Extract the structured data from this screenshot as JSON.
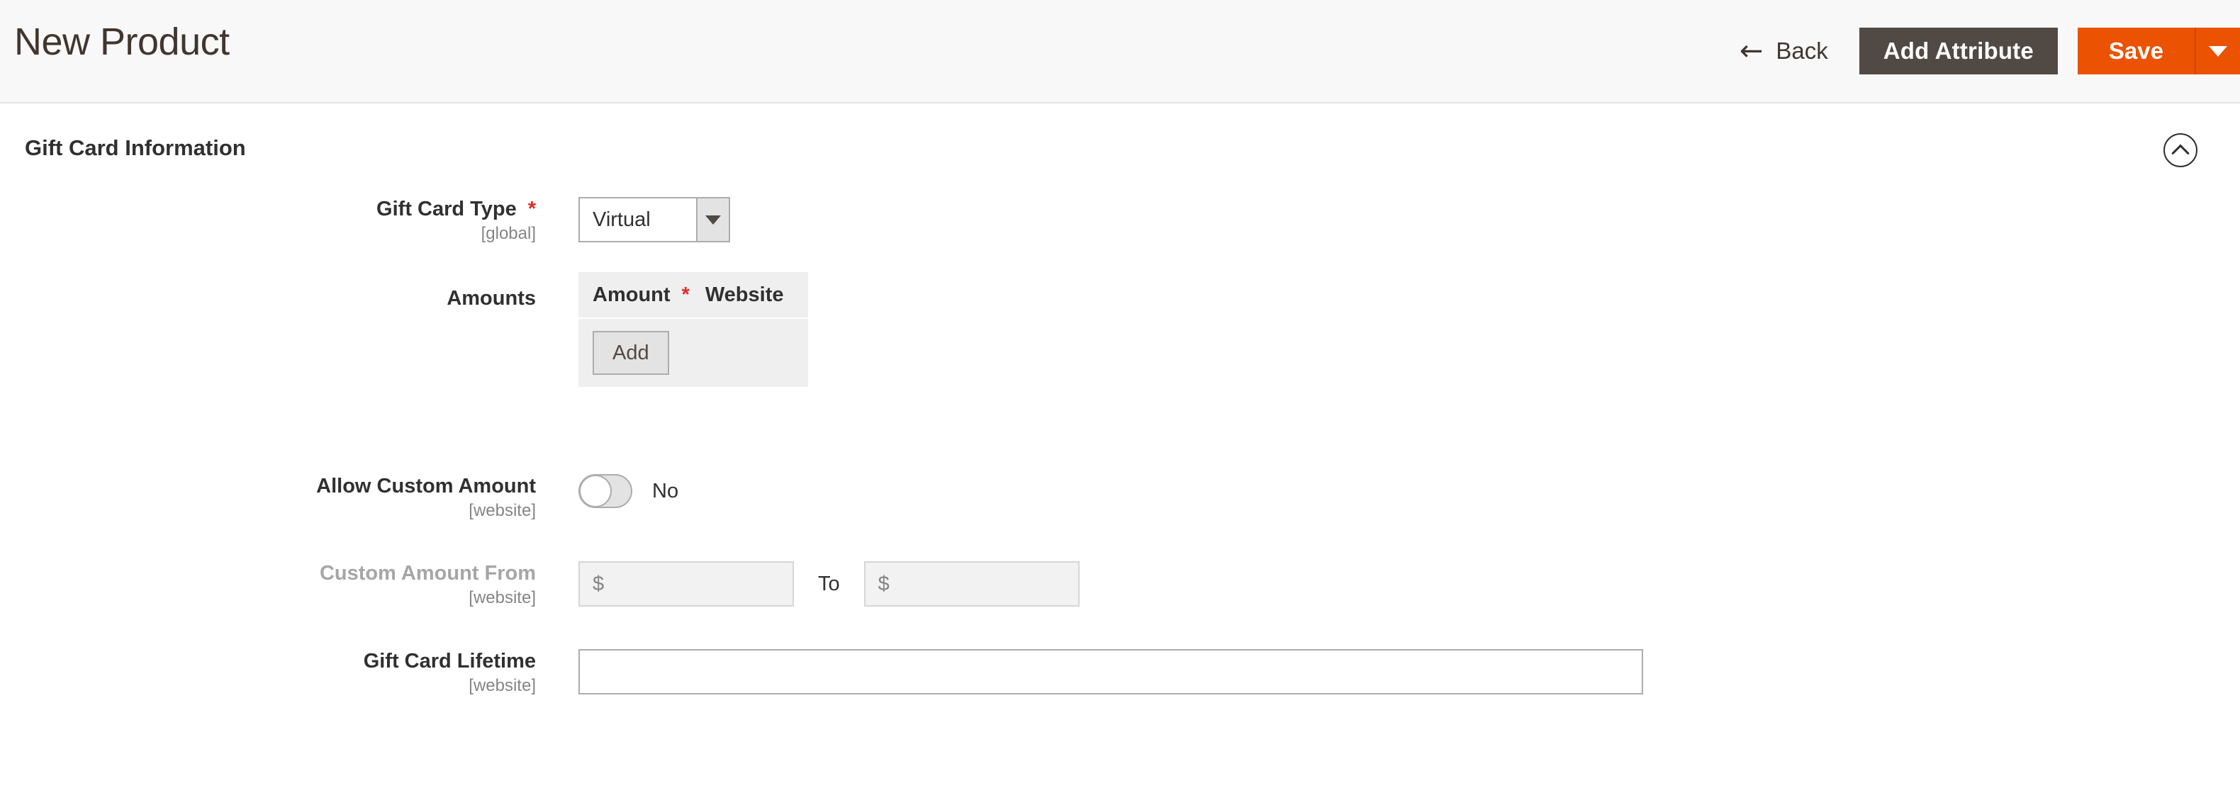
{
  "header": {
    "title": "New Product",
    "back": {
      "label": "Back",
      "icon": "arrow-left-icon"
    },
    "add_attribute_label": "Add Attribute",
    "save_label": "Save",
    "save_toggle_icon": "caret-down-icon"
  },
  "section": {
    "title": "Gift Card Information",
    "collapse_icon": "chevron-up-circle-icon"
  },
  "fields": {
    "gift_card_type": {
      "label": "Gift Card Type",
      "required_marker": "*",
      "scope": "[global]",
      "value": "Virtual",
      "options": [
        "Virtual"
      ]
    },
    "amounts": {
      "label": "Amounts",
      "columns": [
        "Amount",
        "Website"
      ],
      "amount_required_marker": "*",
      "add_label": "Add",
      "rows": []
    },
    "allow_custom_amount": {
      "label": "Allow Custom Amount",
      "scope": "[website]",
      "value": "No",
      "state": "off"
    },
    "custom_amount_from": {
      "label": "Custom Amount From",
      "scope": "[website]",
      "from_value": "",
      "from_placeholder": "$",
      "separator": "To",
      "to_value": "",
      "to_placeholder": "$",
      "disabled": true
    },
    "gift_card_lifetime": {
      "label": "Gift Card Lifetime",
      "scope": "[website]",
      "value": "",
      "placeholder": ""
    }
  },
  "colors": {
    "accent_orange": "#eb5202",
    "dark_button": "#514943",
    "header_bg": "#f8f8f8",
    "required_red": "#e02b27",
    "text_dark": "#303030",
    "text_muted": "#858585"
  }
}
